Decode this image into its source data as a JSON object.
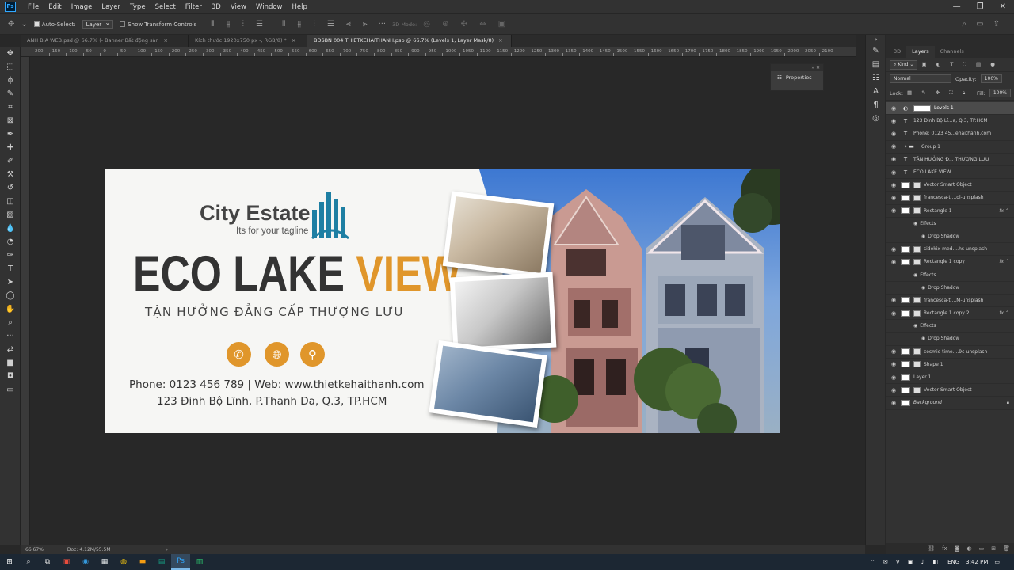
{
  "menu": [
    "File",
    "Edit",
    "Image",
    "Layer",
    "Type",
    "Select",
    "Filter",
    "3D",
    "View",
    "Window",
    "Help"
  ],
  "options": {
    "auto_select": "Auto-Select:",
    "layer_mode": "Layer",
    "show_transform": "Show Transform Controls",
    "mode3d": "3D Mode:"
  },
  "tabs": [
    {
      "label": "ANH BIA WEB.psd @ 66.7% (- Banner Bất động sản"
    },
    {
      "label": "Kích thước 1920x750 px -, RGB/8) *"
    },
    {
      "label": "BDSBN 004 THIETKEHAITHANH.psb @ 66.7% (Levels 1, Layer Mask/8)"
    }
  ],
  "ruler_marks": [
    "200",
    "150",
    "100",
    "50",
    "0",
    "50",
    "100",
    "150",
    "200",
    "250",
    "300",
    "350",
    "400",
    "450",
    "500",
    "550",
    "600",
    "650",
    "700",
    "750",
    "800",
    "850",
    "900",
    "950",
    "1000",
    "1050",
    "1100",
    "1150",
    "1200",
    "1250",
    "1300",
    "1350",
    "1400",
    "1450",
    "1500",
    "1550",
    "1600",
    "1650",
    "1700",
    "1750",
    "1800",
    "1850",
    "1900",
    "1950",
    "2000",
    "2050",
    "2100"
  ],
  "properties": {
    "label": "Properties"
  },
  "banner": {
    "brand": "City Estate",
    "tagline": "Its for your tagline",
    "headline_main": "ECO LAKE ",
    "headline_accent": "VIEW",
    "slogan": "TẬN HƯỞNG ĐẲNG CẤP THƯỢNG LƯU",
    "phone_web": "Phone: 0123 456 789 | Web: www.thietkehaithanh.com",
    "address": "123 Đinh Bộ Lĩnh, P.Thanh Da, Q.3, TP.HCM",
    "accent_color": "#e0962b"
  },
  "layers_panel": {
    "tabs": [
      "3D",
      "Layers",
      "Channels"
    ],
    "kind": "Kind",
    "blend": "Normal",
    "opacity_label": "Opacity:",
    "opacity": "100%",
    "lock_label": "Lock:",
    "fill_label": "Fill:",
    "fill": "100%",
    "layers": [
      {
        "name": "Levels 1",
        "type": "adj",
        "selected": true
      },
      {
        "name": "123 Đinh Bộ Lĩ...a, Q.3, TP.HCM",
        "type": "text"
      },
      {
        "name": "Phone: 0123 45...ehaithanh.com",
        "type": "text"
      },
      {
        "name": "Group 1",
        "type": "group"
      },
      {
        "name": "TẬN HƯỞNG Đ... THƯỢNG LƯU",
        "type": "text"
      },
      {
        "name": "ECO LAKE VIEW",
        "type": "text"
      },
      {
        "name": "Vector Smart Object",
        "type": "smart"
      },
      {
        "name": "francesca-t....ol-unsplash",
        "type": "smart"
      },
      {
        "name": "Rectangle 1",
        "type": "shape",
        "fx": true
      },
      {
        "name": "Effects",
        "type": "effect"
      },
      {
        "name": "Drop Shadow",
        "type": "effect2"
      },
      {
        "name": "sidekix-med....hs-unsplash",
        "type": "smart"
      },
      {
        "name": "Rectangle 1 copy",
        "type": "shape",
        "fx": true
      },
      {
        "name": "Effects",
        "type": "effect"
      },
      {
        "name": "Drop Shadow",
        "type": "effect2"
      },
      {
        "name": "francesca-t....M-unsplash",
        "type": "smart"
      },
      {
        "name": "Rectangle 1 copy 2",
        "type": "shape",
        "fx": true
      },
      {
        "name": "Effects",
        "type": "effect"
      },
      {
        "name": "Drop Shadow",
        "type": "effect2"
      },
      {
        "name": "cosmic-time....9c-unsplash",
        "type": "smart"
      },
      {
        "name": "Shape 1",
        "type": "shape"
      },
      {
        "name": "Layer 1",
        "type": "pixel"
      },
      {
        "name": "Vector Smart Object",
        "type": "smart"
      },
      {
        "name": "Background",
        "type": "bg"
      }
    ]
  },
  "status": {
    "zoom": "66.67%",
    "doc": "Doc: 4.12M/55.5M"
  },
  "taskbar": {
    "lang": "ENG",
    "time": "3:42 PM"
  }
}
